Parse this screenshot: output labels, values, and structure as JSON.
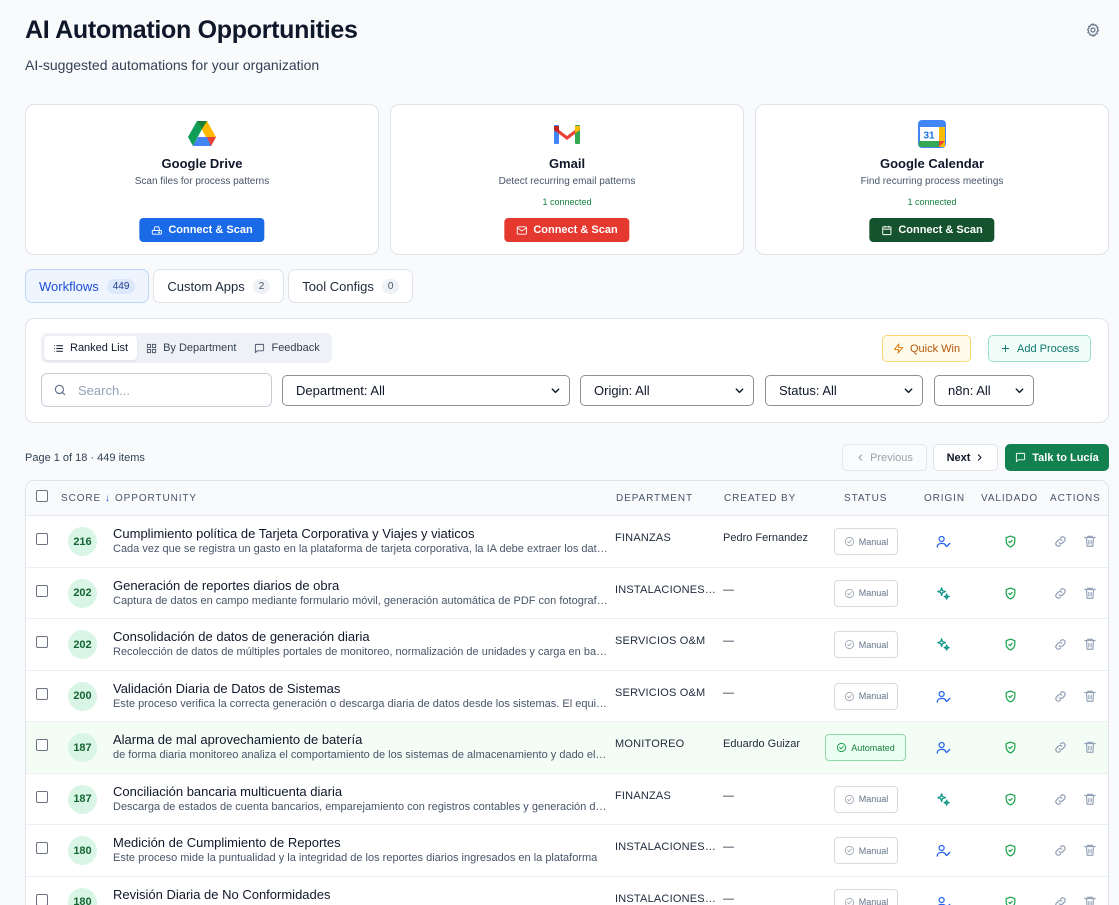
{
  "header": {
    "title": "AI Automation Opportunities",
    "subtitle": "AI-suggested automations for your organization",
    "settings_icon": "gear-icon"
  },
  "integrations": [
    {
      "name": "Google Drive",
      "description": "Scan files for process patterns",
      "connected": "",
      "button": "Connect & Scan",
      "icon": "google-drive-icon",
      "color": "#1a6ae8"
    },
    {
      "name": "Gmail",
      "description": "Detect recurring email patterns",
      "connected": "1 connected",
      "button": "Connect & Scan",
      "icon": "gmail-icon",
      "color": "#e5392f"
    },
    {
      "name": "Google Calendar",
      "description": "Find recurring process meetings",
      "connected": "1 connected",
      "button": "Connect & Scan",
      "icon": "google-calendar-icon",
      "color": "#14532d"
    }
  ],
  "tabs": [
    {
      "label": "Workflows",
      "count": "449"
    },
    {
      "label": "Custom Apps",
      "count": "2"
    },
    {
      "label": "Tool Configs",
      "count": "0"
    }
  ],
  "views": [
    {
      "label": "Ranked List"
    },
    {
      "label": "By Department"
    },
    {
      "label": "Feedback"
    }
  ],
  "actions": {
    "quick_win": "Quick Win",
    "add_process": "Add Process"
  },
  "search": {
    "placeholder": "Search..."
  },
  "filters": {
    "department": "Department: All",
    "origin": "Origin: All",
    "status": "Status: All",
    "n8n": "n8n: All"
  },
  "pagination": {
    "info": "Page 1 of 18 · 449 items",
    "previous": "Previous",
    "next": "Next",
    "talk": "Talk to Lucía"
  },
  "table": {
    "columns": {
      "score": "SCORE",
      "opportunity": "OPPORTUNITY",
      "department": "DEPARTMENT",
      "created_by": "CREATED BY",
      "status": "STATUS",
      "origin": "ORIGIN",
      "validado": "VALIDADO",
      "actions": "ACTIONS"
    },
    "rows": [
      {
        "score": "216",
        "title": "Cumplimiento política de Tarjeta Corporativa y Viajes y viaticos",
        "description": "Cada vez que se registra un gasto en la plataforma de tarjeta corporativa, la IA debe extraer los datos del comprobante y validarlos",
        "department": "FINANZAS",
        "created_by": "Pedro Fernandez",
        "status": "Manual",
        "origin": "user"
      },
      {
        "score": "202",
        "title": "Generación de reportes diarios de obra",
        "description": "Captura de datos en campo mediante formulario móvil, generación automática de PDF con fotografías",
        "department": "INSTALACIONES Y OBRAS",
        "created_by": "—",
        "status": "Manual",
        "origin": "ai"
      },
      {
        "score": "202",
        "title": "Consolidación de datos de generación diaria",
        "description": "Recolección de datos de múltiples portales de monitoreo, normalización de unidades y carga en base de datos",
        "department": "SERVICIOS O&M",
        "created_by": "—",
        "status": "Manual",
        "origin": "ai"
      },
      {
        "score": "200",
        "title": "Validación Diaria de Datos de Sistemas",
        "description": "Este proceso verifica la correcta generación o descarga diaria de datos desde los sistemas. El equipo revisa",
        "department": "SERVICIOS O&M",
        "created_by": "—",
        "status": "Manual",
        "origin": "user"
      },
      {
        "score": "187",
        "title": "Alarma de mal aprovechamiento de batería",
        "description": "de forma diaria monitoreo analiza el comportamiento de los sistemas de almacenamiento y dado el caso",
        "department": "MONITOREO",
        "created_by": "Eduardo Guizar",
        "status": "Automated",
        "origin": "user"
      },
      {
        "score": "187",
        "title": "Conciliación bancaria multicuenta diaria",
        "description": "Descarga de estados de cuenta bancarios, emparejamiento con registros contables y generación de reporte",
        "department": "FINANZAS",
        "created_by": "—",
        "status": "Manual",
        "origin": "ai"
      },
      {
        "score": "180",
        "title": "Medición de Cumplimiento de Reportes",
        "description": "Este proceso mide la puntualidad y la integridad de los reportes diarios ingresados en la plataforma",
        "department": "INSTALACIONES Y OBRAS",
        "created_by": "—",
        "status": "Manual",
        "origin": "user"
      },
      {
        "score": "180",
        "title": "Revisión Diaria de No Conformidades",
        "description": "",
        "department": "INSTALACIONES Y OBRAS",
        "created_by": "—",
        "status": "Manual",
        "origin": "user"
      }
    ]
  }
}
